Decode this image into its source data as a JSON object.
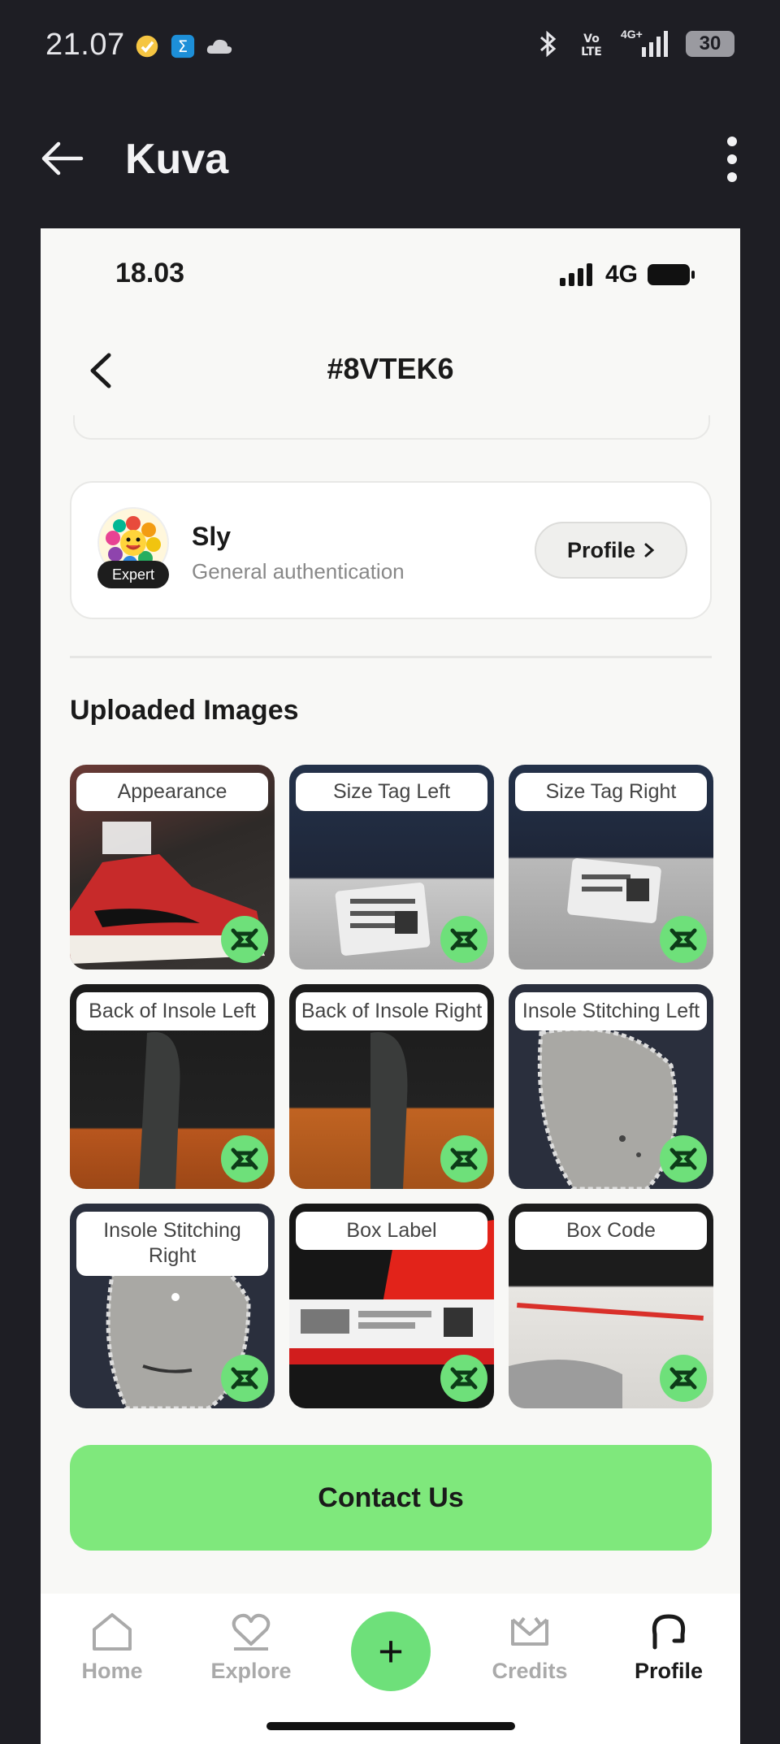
{
  "os_status": {
    "time": "21.07",
    "network": "4G+",
    "battery": "30"
  },
  "appbar": {
    "title": "Kuva"
  },
  "screenshot": {
    "status": {
      "time": "18.03",
      "network": "4G"
    },
    "nav": {
      "title": "#8VTEK6"
    },
    "expert": {
      "badge": "Expert",
      "name": "Sly",
      "subtitle": "General authentication",
      "profile_label": "Profile"
    },
    "section_title": "Uploaded Images",
    "images": [
      {
        "label": "Appearance"
      },
      {
        "label": "Size Tag Left"
      },
      {
        "label": "Size Tag Right"
      },
      {
        "label": "Back of Insole Left"
      },
      {
        "label": "Back of Insole Right"
      },
      {
        "label": "Insole Stitching Left"
      },
      {
        "label": "Insole Stitching Right"
      },
      {
        "label": "Box Label"
      },
      {
        "label": "Box Code"
      }
    ],
    "contact_label": "Contact Us",
    "tabs": {
      "home": "Home",
      "explore": "Explore",
      "credits": "Credits",
      "profile": "Profile",
      "add_symbol": "+"
    }
  },
  "colors": {
    "accent": "#7fe87c",
    "background": "#f8f8f6",
    "chrome": "#1e1e24"
  }
}
